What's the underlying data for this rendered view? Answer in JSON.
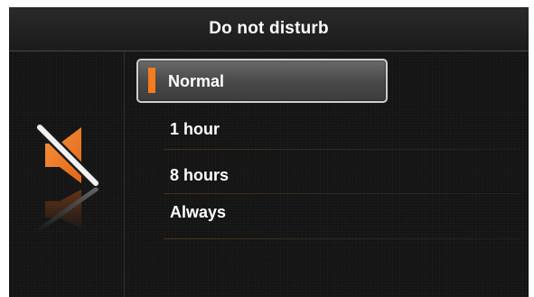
{
  "title": "Do not disturb",
  "icon": "speaker-muted-icon",
  "accent_color": "#f57c1f",
  "menu": {
    "selected_index": 0,
    "items": [
      {
        "label": "Normal"
      },
      {
        "label": "1 hour"
      },
      {
        "label": "8 hours"
      },
      {
        "label": "Always"
      }
    ]
  }
}
